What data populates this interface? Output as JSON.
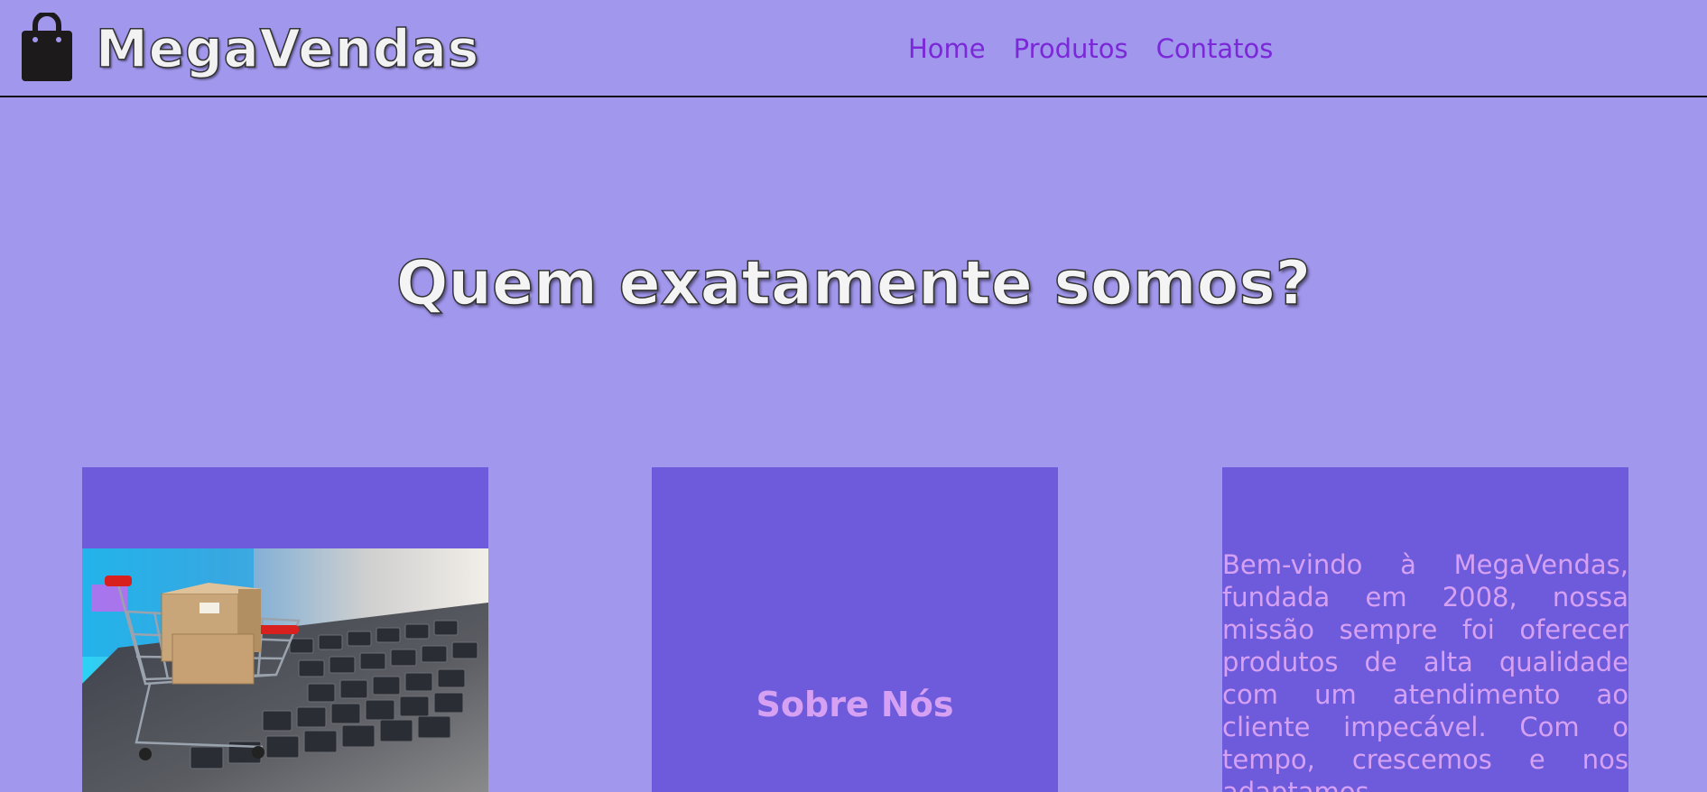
{
  "header": {
    "brand": "MegaVendas",
    "logo_icon": "shopping-bag-icon",
    "nav": [
      {
        "label": "Home"
      },
      {
        "label": "Produtos"
      },
      {
        "label": "Contatos"
      }
    ]
  },
  "hero": {
    "title": "Quem exatamente somos?"
  },
  "cards": {
    "image_card": {
      "image": "shopping-cart-on-laptop-keyboard-image"
    },
    "about_card": {
      "title": "Sobre Nós"
    },
    "text_card": {
      "text": "Bem-vindo à MegaVendas, fundada em 2008, nossa missão sempre foi oferecer produtos de alta qualidade com um atendimento ao cliente impecável. Com o tempo, crescemos e nos adaptamos"
    }
  },
  "colors": {
    "page_background": "#a197ed",
    "card_background": "#6e5bdb",
    "nav_link": "#7b28d8",
    "card_text": "#d6a1f3"
  }
}
